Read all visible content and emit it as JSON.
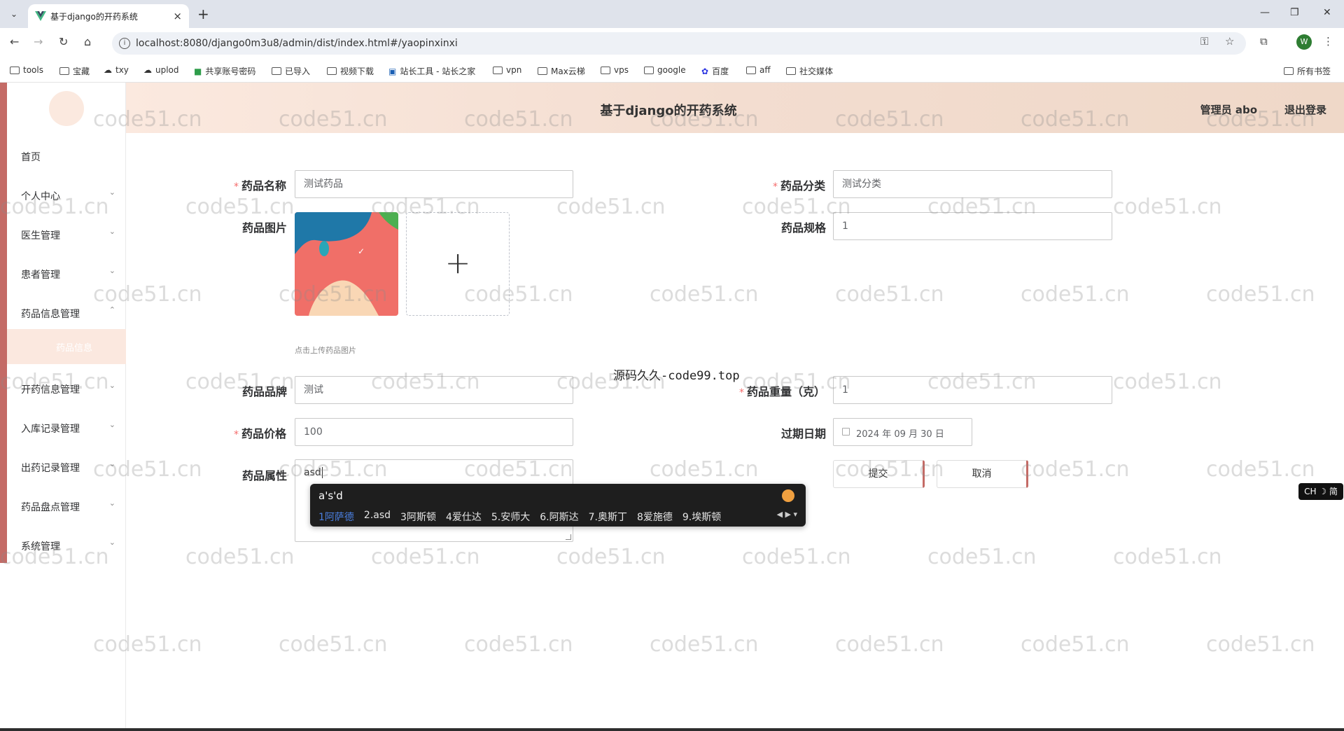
{
  "browser": {
    "tab_title": "基于django的开药系统",
    "url": "localhost:8080/django0m3u8/admin/dist/index.html#/yaopinxinxi",
    "profile_initial": "W",
    "bookmarks": [
      "tools",
      "宝藏",
      "txy",
      "uplod",
      "共享账号密码",
      "已导入",
      "视频下载",
      "站长工具 - 站长之家",
      "vpn",
      "Max云梯",
      "vps",
      "google",
      "百度",
      "aff",
      "社交媒体"
    ],
    "all_bookmarks": "所有书签"
  },
  "header": {
    "title": "基于django的开药系统",
    "user": "管理员 abo",
    "logout": "退出登录"
  },
  "sidebar": {
    "items": [
      {
        "label": "首页",
        "chevron": ""
      },
      {
        "label": "个人中心",
        "chevron": "⌄"
      },
      {
        "label": "医生管理",
        "chevron": "⌄"
      },
      {
        "label": "患者管理",
        "chevron": "⌄"
      },
      {
        "label": "药品信息管理",
        "chevron": "⌃"
      },
      {
        "label": "开药信息管理",
        "chevron": "⌄"
      },
      {
        "label": "入库记录管理",
        "chevron": "⌄"
      },
      {
        "label": "出药记录管理",
        "chevron": "⌄"
      },
      {
        "label": "药品盘点管理",
        "chevron": "⌄"
      },
      {
        "label": "系统管理",
        "chevron": "⌄"
      }
    ],
    "active_sub": "药品信息"
  },
  "form": {
    "name_label": "药品名称",
    "name_value": "测试药品",
    "category_label": "药品分类",
    "category_value": "测试分类",
    "image_label": "药品图片",
    "image_tip": "点击上传药品图片",
    "spec_label": "药品规格",
    "spec_value": "1",
    "brand_label": "药品品牌",
    "brand_value": "测试",
    "weight_label": "药品重量（克）",
    "weight_value": "1",
    "price_label": "药品价格",
    "price_value": "100",
    "expiry_label": "过期日期",
    "expiry_value": "2024 年 09 月 30 日",
    "attr_label": "药品属性",
    "attr_value": "asd",
    "submit": "提交",
    "cancel": "取消"
  },
  "center_note": "源码久久-code99.top",
  "ime": {
    "input": "a's'd",
    "candidates": [
      "1阿萨德",
      "2.asd",
      "3阿斯顿",
      "4爱仕达",
      "5.安师大",
      "6.阿斯达",
      "7.奥斯丁",
      "8爱施德",
      "9.埃斯顿"
    ],
    "lang": "CH ☽ 简"
  },
  "watermark": "code51.cn",
  "colors": {
    "accent": "#c46b66",
    "header_bg": "#fbe9df",
    "required": "#f56c6c"
  }
}
